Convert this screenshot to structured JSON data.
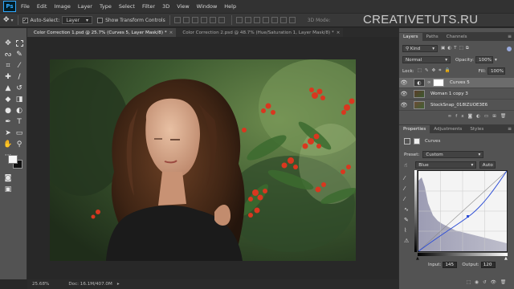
{
  "menubar": {
    "logo": "Ps",
    "items": [
      "File",
      "Edit",
      "Image",
      "Layer",
      "Type",
      "Select",
      "Filter",
      "3D",
      "View",
      "Window",
      "Help"
    ]
  },
  "options": {
    "auto_select_label": "Auto-Select:",
    "auto_select_value": "Layer",
    "transform_label": "Show Transform Controls",
    "mode_3d": "3D Mode:"
  },
  "watermark": "CREATIVETUTS.RU",
  "tabs": [
    {
      "label": "Color Correction 1.psd @ 25.7% (Curves 5, Layer Mask/8) *",
      "close": "×"
    },
    {
      "label": "Color Correction 2.psd @ 48.7% (Hue/Saturation 1, Layer Mask/8) *",
      "close": "×"
    }
  ],
  "status": {
    "zoom": "25.68%",
    "doc": "Doc: 16.1M/407.0M"
  },
  "layers_panel": {
    "tabs": [
      "Layers",
      "Paths",
      "Channels"
    ],
    "kind": "Kind",
    "blend_mode": "Normal",
    "opacity_label": "Opacity:",
    "opacity_value": "100%",
    "lock_label": "Lock:",
    "fill_label": "Fill:",
    "fill_value": "100%",
    "layers": [
      {
        "name": "Curves 5",
        "selected": true
      },
      {
        "name": "Woman 1 copy 3",
        "selected": false
      },
      {
        "name": "StockSnap_018IZUOE3E6",
        "selected": false
      }
    ]
  },
  "properties_panel": {
    "tabs": [
      "Properties",
      "Adjustments",
      "Styles"
    ],
    "title": "Curves",
    "preset_label": "Preset:",
    "preset_value": "Custom",
    "channel_value": "Blue",
    "auto_label": "Auto",
    "input_label": "Input:",
    "input_value": "145",
    "output_label": "Output:",
    "output_value": "120"
  },
  "colors": {
    "accent": "#31a8ff",
    "panel_bg": "#535353",
    "canvas_bg": "#282828",
    "curve_line": "#2f4fd6",
    "histogram": "#9a9ab0"
  }
}
